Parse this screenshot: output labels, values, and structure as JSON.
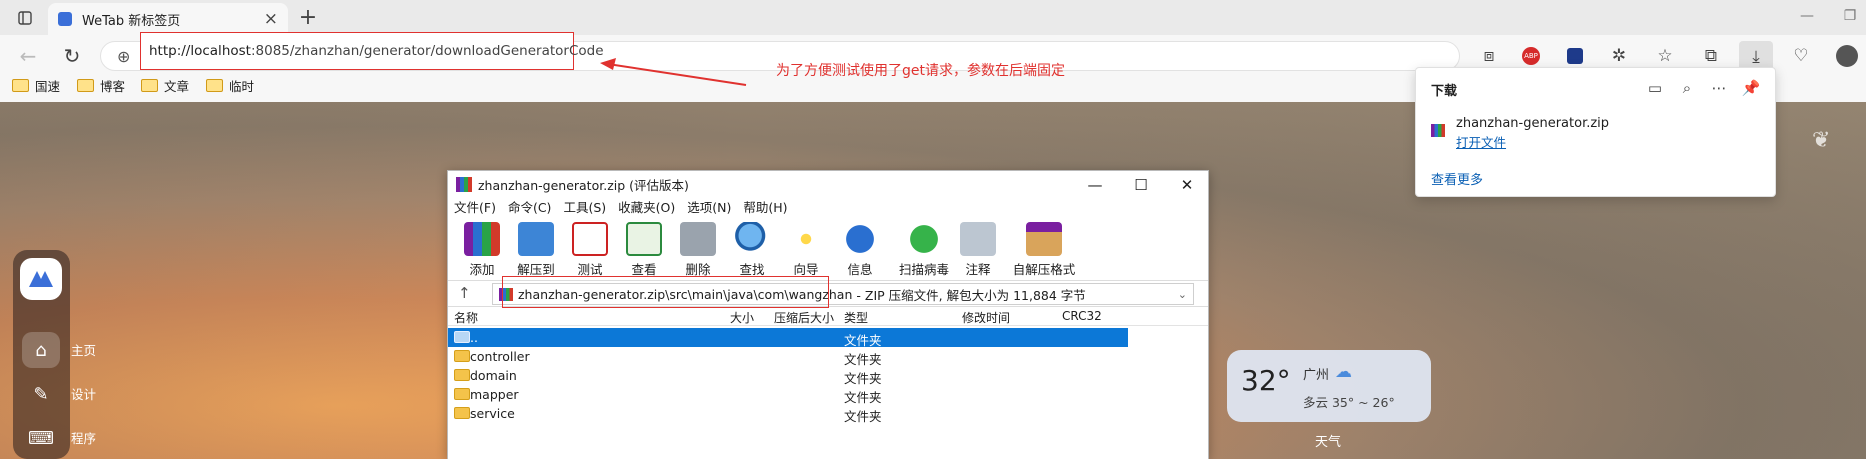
{
  "browser": {
    "tab_title": "WeTab 新标签页",
    "new_tab": "+",
    "url_host": "http://localhost",
    "url_rest": ":8085/zhanzhan/generator/downloadGeneratorCode",
    "annotation": "为了方便测试使用了get请求，参数在后端固定",
    "bookmarks": [
      "国速",
      "博客",
      "文章",
      "临时"
    ]
  },
  "download_panel": {
    "title": "下载",
    "file_name": "zhanzhan-generator.zip",
    "open_label": "打开文件",
    "more_label": "查看更多"
  },
  "sidebar": {
    "items": [
      {
        "label": "主页",
        "icon": "home-icon"
      },
      {
        "label": "设计",
        "icon": "design-icon"
      },
      {
        "label": "程序",
        "icon": "code-icon"
      }
    ]
  },
  "weather": {
    "temp": "32°",
    "city": "广州",
    "desc": "多云 35° ~ 26°",
    "label": "天气"
  },
  "winrar": {
    "title": "zhanzhan-generator.zip (评估版本)",
    "menu": [
      "文件(F)",
      "命令(C)",
      "工具(S)",
      "收藏夹(O)",
      "选项(N)",
      "帮助(H)"
    ],
    "tools": [
      "添加",
      "解压到",
      "测试",
      "查看",
      "删除",
      "查找",
      "向导",
      "信息",
      "扫描病毒",
      "注释",
      "自解压格式"
    ],
    "path": "zhanzhan-generator.zip\\src\\main\\java\\com\\wangzhan",
    "path_info": "- ZIP 压缩文件, 解包大小为 11,884 字节",
    "columns": [
      "名称",
      "大小",
      "压缩后大小",
      "类型",
      "修改时间",
      "CRC32"
    ],
    "rows": [
      {
        "name": "..",
        "type": "文件夹"
      },
      {
        "name": "controller",
        "type": "文件夹"
      },
      {
        "name": "domain",
        "type": "文件夹"
      },
      {
        "name": "mapper",
        "type": "文件夹"
      },
      {
        "name": "service",
        "type": "文件夹"
      }
    ]
  },
  "colors": {
    "accent": "#0c78d7",
    "annotation": "#e0322f"
  }
}
